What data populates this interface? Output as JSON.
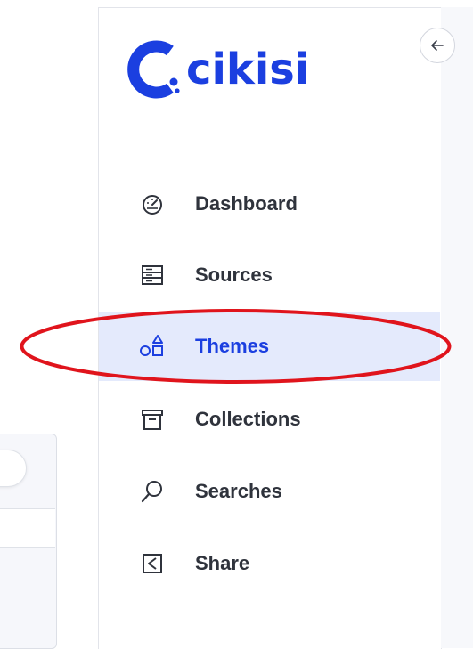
{
  "brand": {
    "name": "cikisi",
    "color": "#1b3fe0"
  },
  "sidebar": {
    "collapse_icon": "arrow-left-icon",
    "items": [
      {
        "label": "Dashboard",
        "icon": "gauge-icon",
        "active": false
      },
      {
        "label": "Sources",
        "icon": "server-icon",
        "active": false
      },
      {
        "label": "Themes",
        "icon": "shapes-icon",
        "active": true
      },
      {
        "label": "Collections",
        "icon": "archive-box-icon",
        "active": false
      },
      {
        "label": "Searches",
        "icon": "search-icon",
        "active": false
      },
      {
        "label": "Share",
        "icon": "share-icon",
        "active": false
      }
    ]
  },
  "colors": {
    "active_bg": "#e4eafc",
    "label_text": "#2f333c",
    "annotation_red": "#e0141c"
  }
}
